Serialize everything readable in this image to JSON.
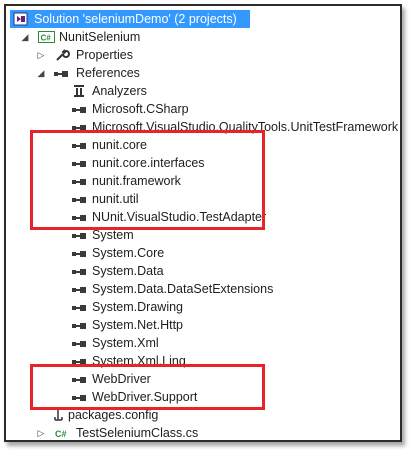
{
  "solution": {
    "label": "Solution 'seleniumDemo' (2 projects)"
  },
  "project": {
    "label": "NunitSelenium",
    "badge": "C#"
  },
  "properties": {
    "label": "Properties"
  },
  "references": {
    "label": "References",
    "items": [
      "Analyzers",
      "Microsoft.CSharp",
      "Microsoft.VisualStudio.QualityTools.UnitTestFramework",
      "nunit.core",
      "nunit.core.interfaces",
      "nunit.framework",
      "nunit.util",
      "NUnit.VisualStudio.TestAdapter",
      "System",
      "System.Core",
      "System.Data",
      "System.Data.DataSetExtensions",
      "System.Drawing",
      "System.Net.Http",
      "System.Xml",
      "System.Xml.Linq",
      "WebDriver",
      "WebDriver.Support"
    ]
  },
  "packages": {
    "label": "packages.config"
  },
  "testfile": {
    "label": "TestSeleniumClass.cs",
    "badge": "C#"
  },
  "colors": {
    "selection": "#3399ff",
    "highlight_box": "#e8232a",
    "csharp": "#2e8b3a"
  }
}
